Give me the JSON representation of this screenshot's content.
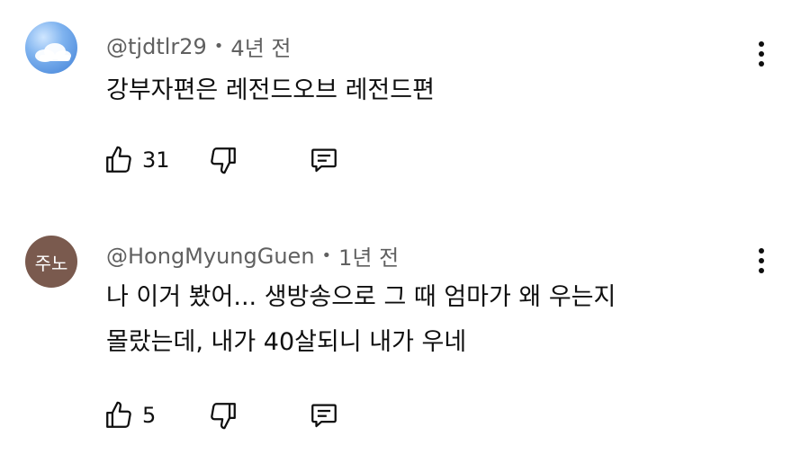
{
  "comments": [
    {
      "author": "@tjdtlr29",
      "separator": "•",
      "time": "4년 전",
      "text_lines": [
        "강부자편은 레전드오브 레전드편"
      ],
      "likes": "31",
      "avatar": {
        "kind": "image",
        "icon": "sky-cloud-avatar"
      }
    },
    {
      "author": "@HongMyungGuen",
      "separator": "•",
      "time": "1년 전",
      "text_lines": [
        "나 이거 봤어... 생방송으로 그 때 엄마가 왜 우는지",
        "몰랐는데, 내가 40살되니 내가 우네"
      ],
      "likes": "5",
      "avatar": {
        "kind": "text",
        "label": "주노",
        "color": "#7a5a4e"
      }
    }
  ],
  "icons": {
    "like": "thumbs-up-icon",
    "dislike": "thumbs-down-icon",
    "reply": "reply-icon",
    "more": "more-vertical-icon"
  }
}
